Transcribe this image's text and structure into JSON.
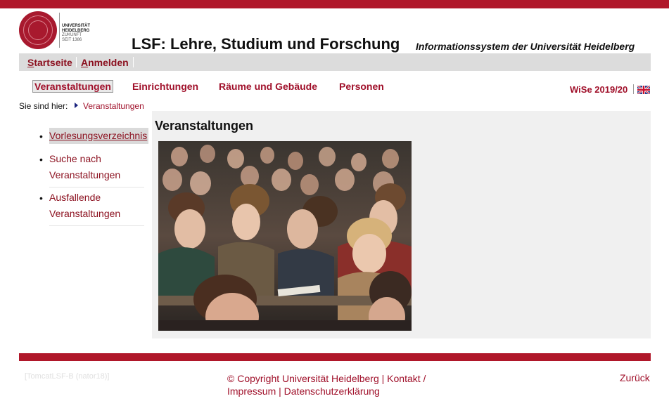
{
  "logo": {
    "line1": "UNIVERSITÄT",
    "line2": "HEIDELBERG",
    "line3": "ZUKUNFT",
    "line4": "SEIT 1386"
  },
  "header": {
    "title": "LSF: Lehre, Studium und Forschung",
    "subtitle": "Informationssystem der Universität Heidelberg"
  },
  "user_bar": {
    "home_accel": "S",
    "home_rest": "tartseite",
    "login_accel": "A",
    "login_rest": "nmelden"
  },
  "main_nav": [
    {
      "label": "Veranstaltungen",
      "active": true
    },
    {
      "label": "Einrichtungen"
    },
    {
      "label": "Räume und Gebäude"
    },
    {
      "label": "Personen"
    }
  ],
  "semester": {
    "label": "WiSe 2019/20",
    "language_icon": "uk-flag-icon"
  },
  "breadcrumb": {
    "prefix": "Sie sind hier:",
    "current": "Veranstaltungen"
  },
  "sidebar": {
    "items": [
      {
        "label": "Vorlesungsverzeichnis",
        "active": true
      },
      {
        "label_line1": "Suche nach",
        "label_line2": "Veranstaltungen"
      },
      {
        "label_line1": "Ausfallende",
        "label_line2": "Veranstaltungen"
      }
    ]
  },
  "content": {
    "title": "Veranstaltungen",
    "image_description_icon": "lecture-hall-photo"
  },
  "footer": {
    "server_id": "[TomcatLSF-B (nator18)]",
    "copyright": "© Copyright Universität Heidelberg",
    "contact": "Kontakt",
    "imprint": "Impressum",
    "privacy": "Datenschutzerklärung",
    "back": "Zurück"
  },
  "colors": {
    "brand_red": "#b0172a",
    "link_red": "#a0102a",
    "panel_gray": "#f0f0f0",
    "bar_gray": "#dcdcdc"
  }
}
